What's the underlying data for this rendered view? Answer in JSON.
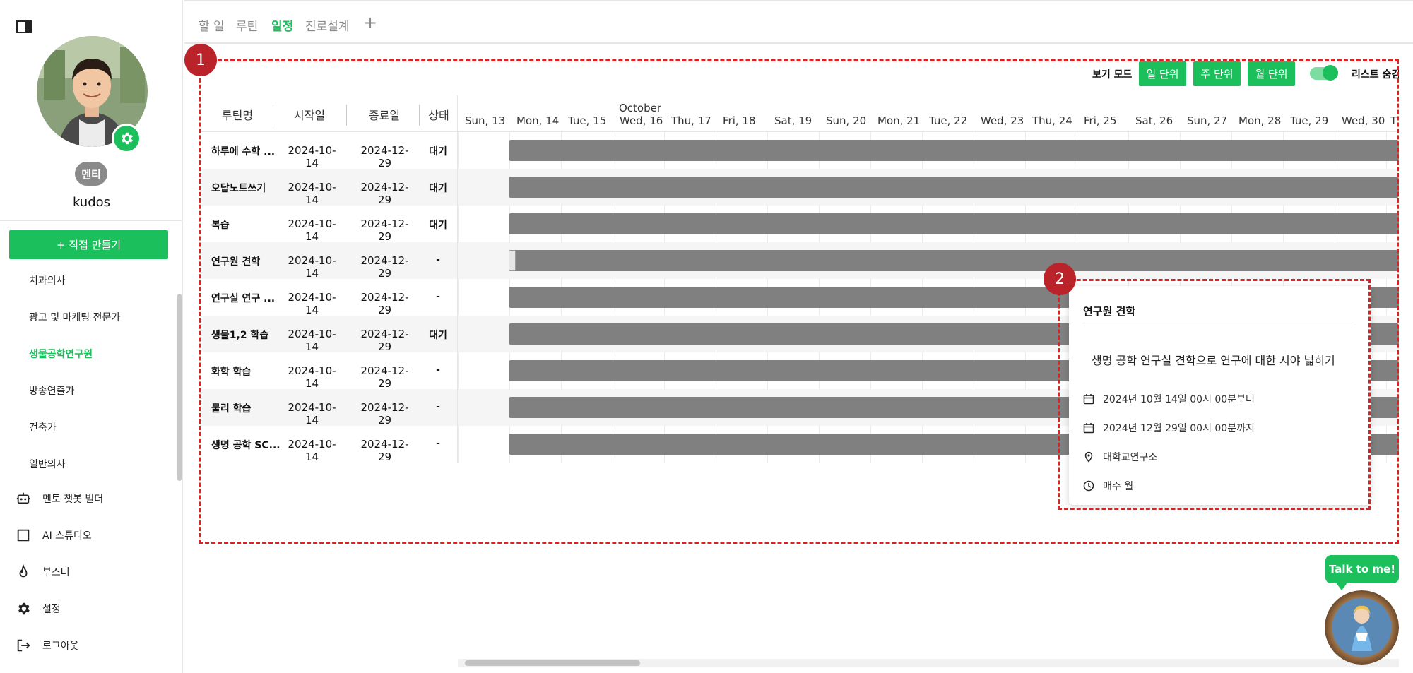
{
  "colors": {
    "accent": "#1bbf5c",
    "marker": "#b92329",
    "annotation": "#e02020",
    "bar": "#808080"
  },
  "sidebar": {
    "toggle_icon": "sidebar-toggle-icon",
    "role_badge": "멘티",
    "username": "kudos",
    "create_button": "+ 직접 만들기",
    "jobs": [
      "치과의사",
      "광고 및 마케팅 전문가",
      "생물공학연구원",
      "방송연출가",
      "건축가",
      "일반의사"
    ],
    "active_job": "생물공학연구원",
    "menu": [
      {
        "label": "멘토 챗봇 빌더",
        "icon": "robot-icon"
      },
      {
        "label": "AI 스튜디오",
        "icon": "square-icon"
      },
      {
        "label": "부스터",
        "icon": "flame-icon"
      },
      {
        "label": "설정",
        "icon": "gear-icon"
      },
      {
        "label": "로그아웃",
        "icon": "logout-icon"
      }
    ]
  },
  "tabs": [
    {
      "label": "할 일"
    },
    {
      "label": "루틴"
    },
    {
      "label": "일정",
      "active": true
    },
    {
      "label": "진로설계"
    }
  ],
  "tab_add": "+",
  "markers": {
    "one": "1",
    "two": "2"
  },
  "view_mode": {
    "label": "보기 모드",
    "buttons": [
      "일 단위",
      "주 단위",
      "월 단위"
    ],
    "list_hide_label": "리스트 숨김",
    "list_hide_on": true
  },
  "table": {
    "headers": {
      "name": "루틴명",
      "start": "시작일",
      "end": "종료일",
      "state": "상태"
    },
    "rows": [
      {
        "name": "하루에 수학 ...",
        "start": "2024-10-14",
        "end": "2024-12-29",
        "state": "대기"
      },
      {
        "name": "오답노트쓰기",
        "start": "2024-10-14",
        "end": "2024-12-29",
        "state": "대기"
      },
      {
        "name": "복습",
        "start": "2024-10-14",
        "end": "2024-12-29",
        "state": "대기"
      },
      {
        "name": "연구원 견학",
        "start": "2024-10-14",
        "end": "2024-12-29",
        "state": "-"
      },
      {
        "name": "연구실 연구 ...",
        "start": "2024-10-14",
        "end": "2024-12-29",
        "state": "-"
      },
      {
        "name": "생물1,2 학습",
        "start": "2024-10-14",
        "end": "2024-12-29",
        "state": "대기"
      },
      {
        "name": "화학 학습",
        "start": "2024-10-14",
        "end": "2024-12-29",
        "state": "-"
      },
      {
        "name": "물리 학습",
        "start": "2024-10-14",
        "end": "2024-12-29",
        "state": "-"
      },
      {
        "name": "생명 공학 SC...",
        "start": "2024-10-14",
        "end": "2024-12-29",
        "state": "-"
      }
    ]
  },
  "gantt": {
    "month": "October",
    "days": [
      "Sun, 13",
      "Mon, 14",
      "Tue, 15",
      "Wed, 16",
      "Thu, 17",
      "Fri, 18",
      "Sat, 19",
      "Sun, 20",
      "Mon, 21",
      "Tue, 22",
      "Wed, 23",
      "Thu, 24",
      "Fri, 25",
      "Sat, 26",
      "Sun, 27",
      "Mon, 28",
      "Tue, 29",
      "Wed, 30",
      "T"
    ]
  },
  "popup": {
    "title": "연구원 견학",
    "description": "생명 공학 연구실 견학으로 연구에 대한 시야 넓히기",
    "start": "2024년 10월 14일 00시 00분부터",
    "end": "2024년 12월 29일 00시 00분까지",
    "location": "대학교연구소",
    "repeat": "매주  월"
  },
  "chatbot": {
    "label": "Talk to me!"
  }
}
